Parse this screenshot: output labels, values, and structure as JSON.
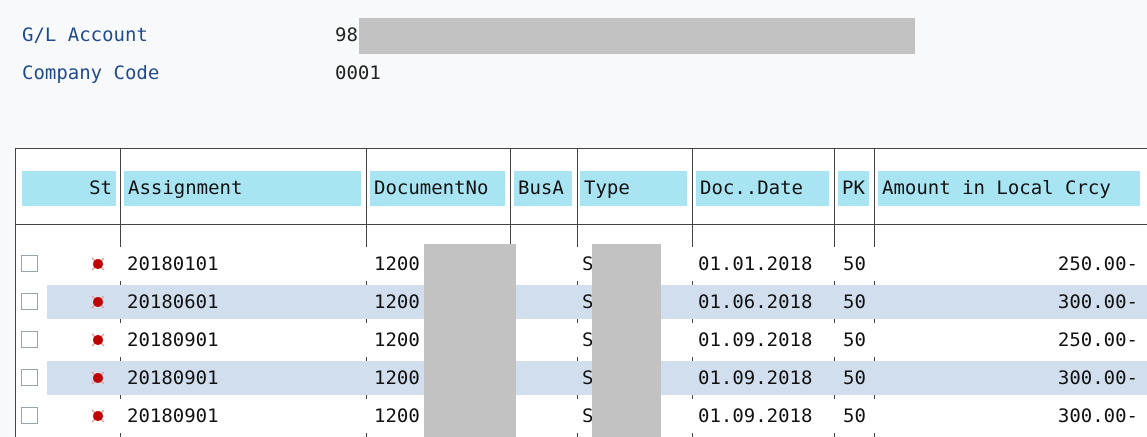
{
  "header": {
    "gl_account_label": "G/L Account",
    "gl_account_value": "98",
    "company_code_label": "Company Code",
    "company_code_value": "0001"
  },
  "columns": {
    "status": "St",
    "assignment": "Assignment",
    "document_no": "DocumentNo",
    "business_area": "BusA",
    "type": "Type",
    "doc_date": "Doc..Date",
    "posting_key": "PK",
    "amount": "Amount in Local Crcy"
  },
  "status_icon": "red-status-light-icon",
  "colors": {
    "header_bg": "#a8e4f1",
    "alt_row_bg": "#d1deee",
    "status_red": "#c00000",
    "label_blue": "#1f4b8e"
  },
  "rows": [
    {
      "assignment": "20180101",
      "document_no": "1200",
      "business_area": "",
      "type": "S",
      "doc_date": "01.01.2018",
      "posting_key": "50",
      "amount": "250.00-"
    },
    {
      "assignment": "20180601",
      "document_no": "1200",
      "business_area": "",
      "type": "S",
      "doc_date": "01.06.2018",
      "posting_key": "50",
      "amount": "300.00-"
    },
    {
      "assignment": "20180901",
      "document_no": "1200",
      "business_area": "",
      "type": "S",
      "doc_date": "01.09.2018",
      "posting_key": "50",
      "amount": "250.00-"
    },
    {
      "assignment": "20180901",
      "document_no": "1200",
      "business_area": "",
      "type": "S",
      "doc_date": "01.09.2018",
      "posting_key": "50",
      "amount": "300.00-"
    },
    {
      "assignment": "20180901",
      "document_no": "1200",
      "business_area": "",
      "type": "S",
      "doc_date": "01.09.2018",
      "posting_key": "50",
      "amount": "300.00-"
    }
  ]
}
